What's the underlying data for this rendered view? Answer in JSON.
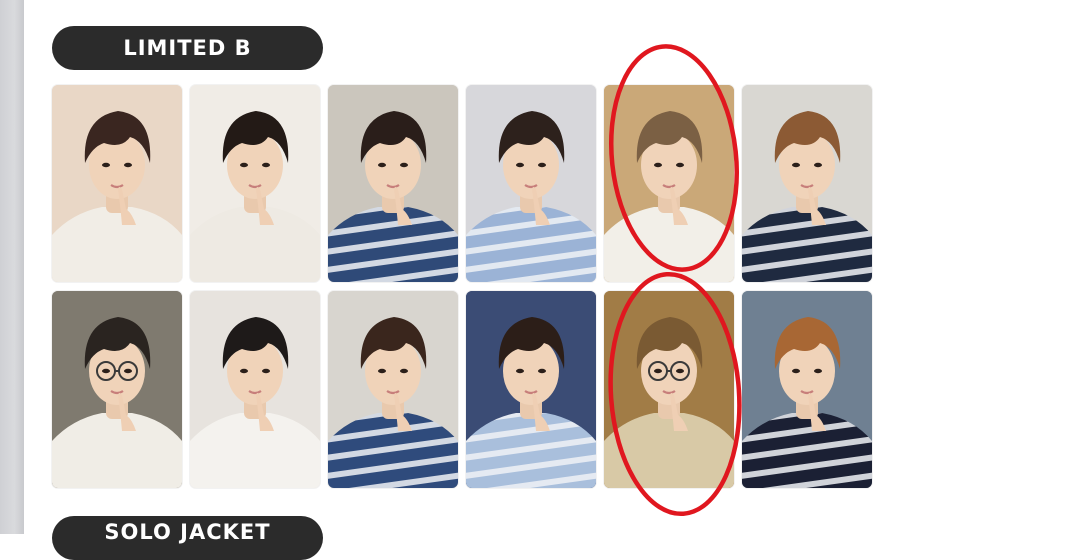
{
  "sections": {
    "limited_b": {
      "label": "LIMITED B"
    },
    "solo_jacket": {
      "label": "SOLO JACKET"
    }
  },
  "photocards": [
    {
      "name": "photocard",
      "bg": "#e9d7c6",
      "shirt": "#f1ede6",
      "stripes": false,
      "hair": "#3a2620",
      "glasses": false
    },
    {
      "name": "photocard",
      "bg": "#f0ece6",
      "shirt": "#eeeae3",
      "stripes": false,
      "hair": "#231a16",
      "glasses": false
    },
    {
      "name": "photocard",
      "bg": "#cbc6bd",
      "shirt": "#2f4a78",
      "stripes": true,
      "hair": "#2a1e1a",
      "glasses": false
    },
    {
      "name": "photocard",
      "bg": "#d7d7db",
      "shirt": "#9bb3d6",
      "stripes": true,
      "hair": "#2d211c",
      "glasses": false
    },
    {
      "name": "photocard",
      "bg": "#caa878",
      "shirt": "#f2efe8",
      "stripes": false,
      "hair": "#7b6044",
      "glasses": false
    },
    {
      "name": "photocard",
      "bg": "#d9d7d2",
      "shirt": "#1f2a40",
      "stripes": true,
      "hair": "#8c5a34",
      "glasses": false
    },
    {
      "name": "photocard",
      "bg": "#7f7a6f",
      "shirt": "#f0ede6",
      "stripes": false,
      "hair": "#2a2420",
      "glasses": true
    },
    {
      "name": "photocard",
      "bg": "#e7e3de",
      "shirt": "#f4f2ee",
      "stripes": false,
      "hair": "#1e1a19",
      "glasses": false
    },
    {
      "name": "photocard",
      "bg": "#d8d5cf",
      "shirt": "#2f4b7c",
      "stripes": true,
      "hair": "#3a261d",
      "glasses": false
    },
    {
      "name": "photocard",
      "bg": "#3b4c75",
      "shirt": "#a9bfdc",
      "stripes": true,
      "hair": "#2c1e18",
      "glasses": false
    },
    {
      "name": "photocard",
      "bg": "#a17c46",
      "shirt": "#d8c9a6",
      "stripes": false,
      "hair": "#7a5a33",
      "glasses": true
    },
    {
      "name": "photocard",
      "bg": "#6f8092",
      "shirt": "#1b2034",
      "stripes": true,
      "hair": "#a86734",
      "glasses": false
    }
  ],
  "colors": {
    "pill_bg": "#2b2b2b",
    "highlight_circle": "#e0171f"
  }
}
